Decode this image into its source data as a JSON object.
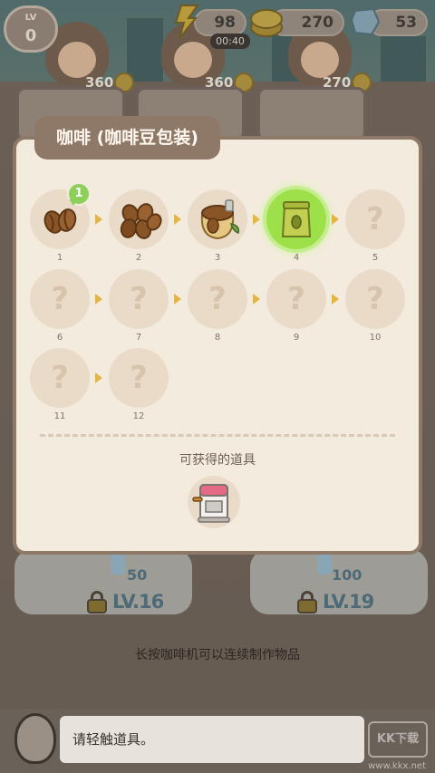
{
  "hud": {
    "level_caption": "LV",
    "level_value": "0",
    "energy": "98",
    "energy_timer": "00:40",
    "coins": "270",
    "gems": "53"
  },
  "customers": [
    {
      "price": "360"
    },
    {
      "price": "360"
    },
    {
      "price": "270"
    }
  ],
  "panel": {
    "title": "咖啡 (咖啡豆包装)",
    "new_badge": "1",
    "nodes": [
      {
        "label": "1",
        "state": "unlocked",
        "icon": "coffee-beans-icon"
      },
      {
        "label": "2",
        "state": "unlocked",
        "icon": "coffee-beans-pile-icon"
      },
      {
        "label": "3",
        "state": "unlocked",
        "icon": "coffee-bean-sack-icon"
      },
      {
        "label": "4",
        "state": "current",
        "icon": "coffee-bag-icon"
      },
      {
        "label": "5",
        "state": "unknown",
        "icon": "question-icon"
      },
      {
        "label": "6",
        "state": "unknown",
        "icon": "question-icon"
      },
      {
        "label": "7",
        "state": "unknown",
        "icon": "question-icon"
      },
      {
        "label": "8",
        "state": "unknown",
        "icon": "question-icon"
      },
      {
        "label": "9",
        "state": "unknown",
        "icon": "question-icon"
      },
      {
        "label": "10",
        "state": "unknown",
        "icon": "question-icon"
      },
      {
        "label": "11",
        "state": "unknown",
        "icon": "question-icon"
      },
      {
        "label": "12",
        "state": "unknown",
        "icon": "question-icon"
      }
    ],
    "unknown_mark": "?",
    "obtainable_label": "可获得的道具",
    "obtainable_item_icon": "coffee-machine-icon"
  },
  "locked_items": [
    {
      "cost": "50",
      "level": "LV.16"
    },
    {
      "cost": "100",
      "level": "LV.19"
    }
  ],
  "hint": "长按咖啡机可以连续制作物品",
  "toast": "请轻触道具。",
  "watermark": {
    "logo": "KK下载",
    "url": "www.kkx.net"
  }
}
